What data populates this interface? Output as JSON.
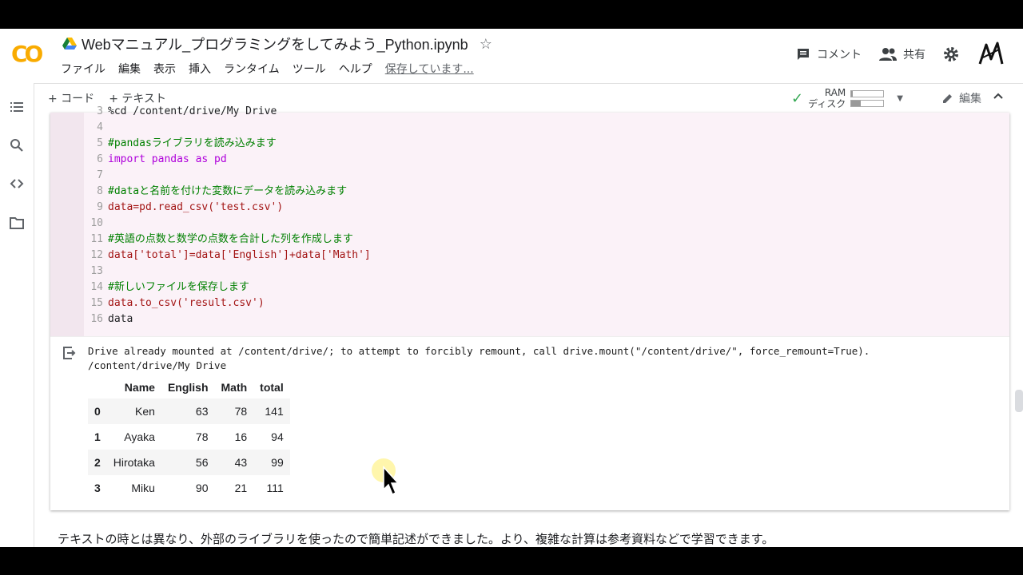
{
  "app": {
    "logo": "CO"
  },
  "notebook": {
    "title": "Webマニュアル_プログラミングをしてみよう_Python.ipynb",
    "star": "☆"
  },
  "menu": {
    "items": [
      "ファイル",
      "編集",
      "表示",
      "挿入",
      "ランタイム",
      "ツール",
      "ヘルプ"
    ],
    "saving_status": "保存しています..."
  },
  "header": {
    "comment_label": "コメント",
    "share_label": "共有"
  },
  "toolbar": {
    "add_code": "+ コード",
    "add_text": "+ テキスト",
    "ram_label": "RAM",
    "disk_label": "ディスク",
    "ram_usage": 0.05,
    "disk_usage": 0.3,
    "edit_label": "編集"
  },
  "code_cell": {
    "lines": [
      {
        "n": "3",
        "text": "%cd /content/drive/My Drive"
      },
      {
        "n": "4",
        "text": ""
      },
      {
        "n": "5",
        "text": "#pandasライブラリを読み込みます"
      },
      {
        "n": "6",
        "text": "import pandas as pd"
      },
      {
        "n": "7",
        "text": ""
      },
      {
        "n": "8",
        "text": "#dataと名前を付けた変数にデータを読み込みます"
      },
      {
        "n": "9",
        "text": "data=pd.read_csv('test.csv')"
      },
      {
        "n": "10",
        "text": ""
      },
      {
        "n": "11",
        "text": "#英語の点数と数学の点数を合計した列を作成します"
      },
      {
        "n": "12",
        "text": "data['total']=data['English']+data['Math']"
      },
      {
        "n": "13",
        "text": ""
      },
      {
        "n": "14",
        "text": "#新しいファイルを保存します"
      },
      {
        "n": "15",
        "text": "data.to_csv('result.csv')"
      },
      {
        "n": "16",
        "text": "data"
      }
    ]
  },
  "output": {
    "line1": "Drive already mounted at /content/drive/; to attempt to forcibly remount, call drive.mount(\"/content/drive/\", force_remount=True).",
    "line2": "/content/drive/My Drive",
    "table": {
      "columns": [
        "",
        "Name",
        "English",
        "Math",
        "total"
      ],
      "rows": [
        [
          "0",
          "Ken",
          "63",
          "78",
          "141"
        ],
        [
          "1",
          "Ayaka",
          "78",
          "16",
          "94"
        ],
        [
          "2",
          "Hirotaka",
          "56",
          "43",
          "99"
        ],
        [
          "3",
          "Miku",
          "90",
          "21",
          "111"
        ]
      ]
    }
  },
  "text_cell": {
    "text": "テキストの時とは異なり、外部のライブラリを使ったので簡単記述ができました。より、複雑な計算は参考資料などで学習できます。"
  }
}
